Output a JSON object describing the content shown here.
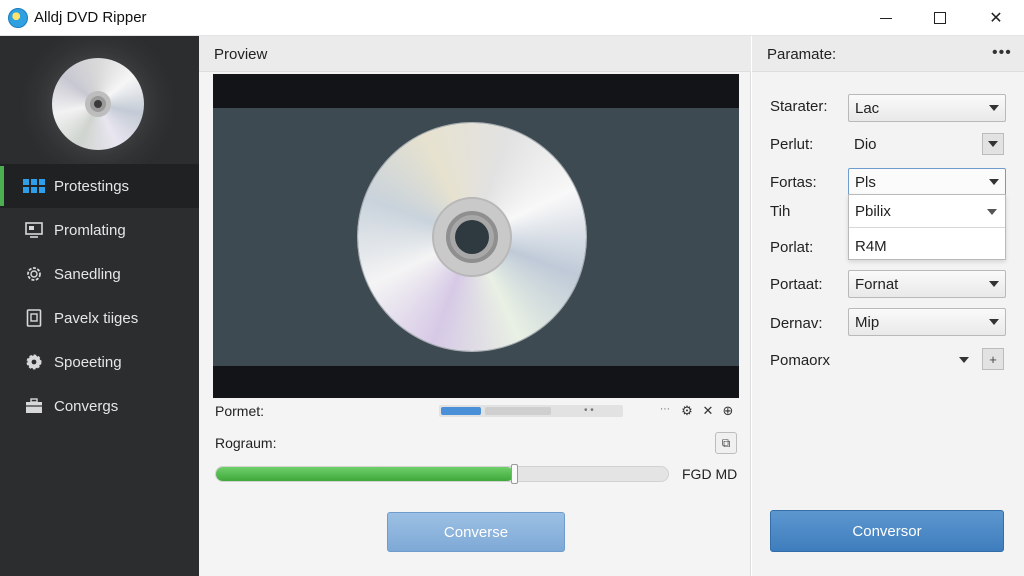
{
  "window": {
    "title": "Alldj DVD Ripper",
    "controls": {
      "minimize": "minimize",
      "maximize": "maximize",
      "close": "✕"
    }
  },
  "sidebar": {
    "items": [
      {
        "label": "Protestings",
        "icon": "grid-icon",
        "active": true
      },
      {
        "label": "Promlating",
        "icon": "monitor-icon",
        "active": false
      },
      {
        "label": "Sanedling",
        "icon": "gear-outline-icon",
        "active": false
      },
      {
        "label": "Pavelx tiiges",
        "icon": "document-icon",
        "active": false
      },
      {
        "label": "Spoeeting",
        "icon": "gear-icon",
        "active": false
      },
      {
        "label": "Convergs",
        "icon": "toolbox-icon",
        "active": false
      }
    ]
  },
  "preview": {
    "title": "Proview",
    "format_label": "Pormet:",
    "format_controls": {
      "dots": "• •",
      "more": "⋯",
      "settings": "⚙",
      "close": "✕",
      "target": "⊕"
    },
    "progress_label": "Rograum:",
    "progress_icon": "⧉",
    "progress_fraction": 0.66,
    "size_text": "FGD MD",
    "convert_label": "Converse"
  },
  "params": {
    "title": "Paramate:",
    "more": "•••",
    "rows": {
      "starter": {
        "label": "Starater:",
        "value": "Lac"
      },
      "perlut": {
        "label": "Perlut:",
        "value": "Dio"
      },
      "fortas": {
        "label": "Fortas:",
        "value": "Pls"
      },
      "tih": {
        "label": "Tih"
      },
      "porlat": {
        "label": "Porlat:"
      },
      "portaat": {
        "label": "Portaat:",
        "value": "Fornat"
      },
      "dernav": {
        "label": "Dernav:",
        "value": "Mip"
      },
      "pornaorx": {
        "label": "Pomaorx"
      }
    },
    "dropdown_options": [
      "Pbilix",
      "R4M"
    ],
    "plus_icon": "+",
    "convert_label": "Conversor"
  },
  "colors": {
    "sidebar_bg": "#2b2d2f",
    "active_accent": "#4caf50",
    "progress_green": "#3ea83a",
    "button_blue": "#4a86c4"
  }
}
